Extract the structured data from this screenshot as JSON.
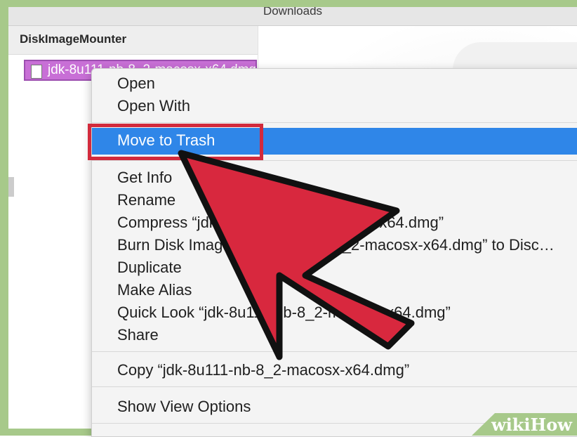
{
  "window": {
    "title": "Downloads"
  },
  "sidebar": {
    "header": "DiskImageMounter",
    "selected_file": "jdk-8u111-nb-8_2-macosx-x64.dmg"
  },
  "context_menu": {
    "items": [
      "Open",
      "Open With",
      "Move to Trash",
      "Get Info",
      "Rename",
      "Compress “jdk-8u111-nb-8_2-macosx-x64.dmg”",
      "Burn Disk Image “jdk-8u111-nb-8_2-macosx-x64.dmg” to Disc…",
      "Duplicate",
      "Make Alias",
      "Quick Look “jdk-8u111-nb-8_2-macosx-x64.dmg”",
      "Share",
      "Copy “jdk-8u111-nb-8_2-macosx-x64.dmg”",
      "Show View Options"
    ],
    "highlighted_item": "Move to Trash"
  },
  "colors": {
    "highlight": "#2f86e8",
    "callout": "#d22a3c",
    "selection": "#c86fd6",
    "watermark": "#a7c98a"
  },
  "watermark": "wikiHow"
}
